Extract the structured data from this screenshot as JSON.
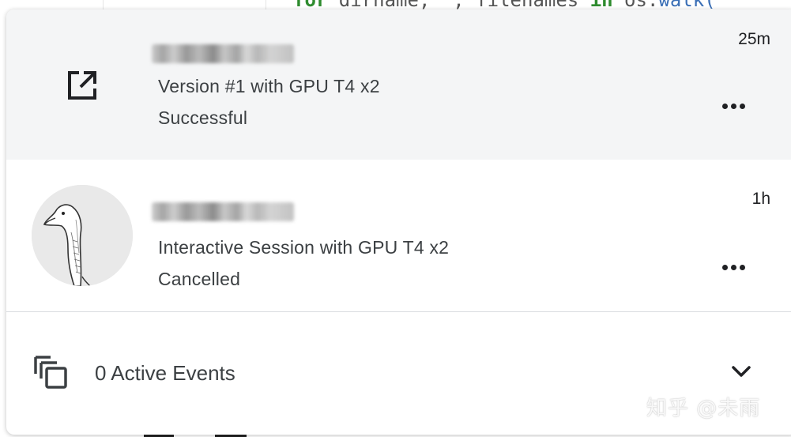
{
  "background": {
    "code_snippet": {
      "keyword": "for",
      "text": " dirname, _, filenames ",
      "keyword2": "in",
      "tail": " os.",
      "fn": "walk("
    }
  },
  "sessions": [
    {
      "icon": "external-link-icon",
      "title_redacted": true,
      "subtitle": "Version #1 with GPU T4 x2",
      "status": "Successful",
      "time": "25m"
    },
    {
      "icon": "goose-avatar",
      "title_redacted": true,
      "subtitle": "Interactive Session with GPU T4 x2",
      "status": "Cancelled",
      "time": "1h"
    }
  ],
  "events": {
    "icon": "copy-stack-icon",
    "label": "0 Active Events",
    "toggle_icon": "chevron-down-icon"
  },
  "watermark": "知乎 @未雨",
  "colors": {
    "highlight_row": "#f4f5f6",
    "text": "#3c4043",
    "divider": "#dadce0"
  }
}
